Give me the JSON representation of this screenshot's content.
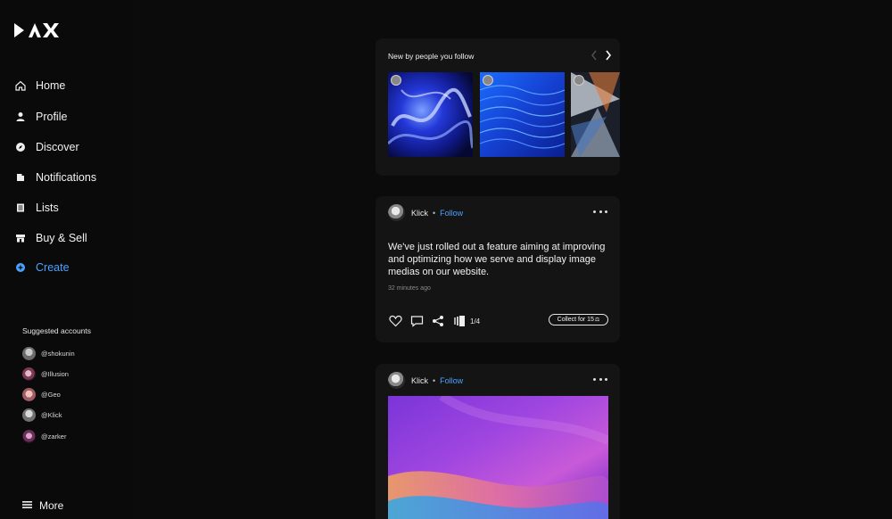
{
  "brand": {
    "logo_text": "DAX"
  },
  "sidebar": {
    "items": [
      {
        "label": "Home",
        "icon": "home-icon"
      },
      {
        "label": "Profile",
        "icon": "user-icon"
      },
      {
        "label": "Discover",
        "icon": "compass-icon"
      },
      {
        "label": "Notifications",
        "icon": "bell-icon"
      },
      {
        "label": "Lists",
        "icon": "list-icon"
      },
      {
        "label": "Buy & Sell",
        "icon": "store-icon"
      },
      {
        "label": "Create",
        "icon": "plus-circle-icon"
      }
    ],
    "suggested_title": "Suggested accounts",
    "suggested": [
      {
        "handle": "@shokunin"
      },
      {
        "handle": "@Illusion"
      },
      {
        "handle": "@Geo"
      },
      {
        "handle": "@Klick"
      },
      {
        "handle": "@zarker"
      }
    ],
    "more_label": "More"
  },
  "feed": {
    "carousel": {
      "title": "New by people you follow"
    },
    "post1": {
      "author": "Klick",
      "follow_label": "Follow",
      "text": "We've just rolled out a feature aiming at improving and optimizing how we serve and display image medias on our website.",
      "time": "32 minutes ago",
      "pages": "1/4",
      "collect_label": "Collect for 15"
    },
    "post2": {
      "author": "Klick",
      "follow_label": "Follow"
    }
  },
  "colors": {
    "accent": "#4aa3ff",
    "background": "#0b0b0b",
    "card": "#141414"
  }
}
